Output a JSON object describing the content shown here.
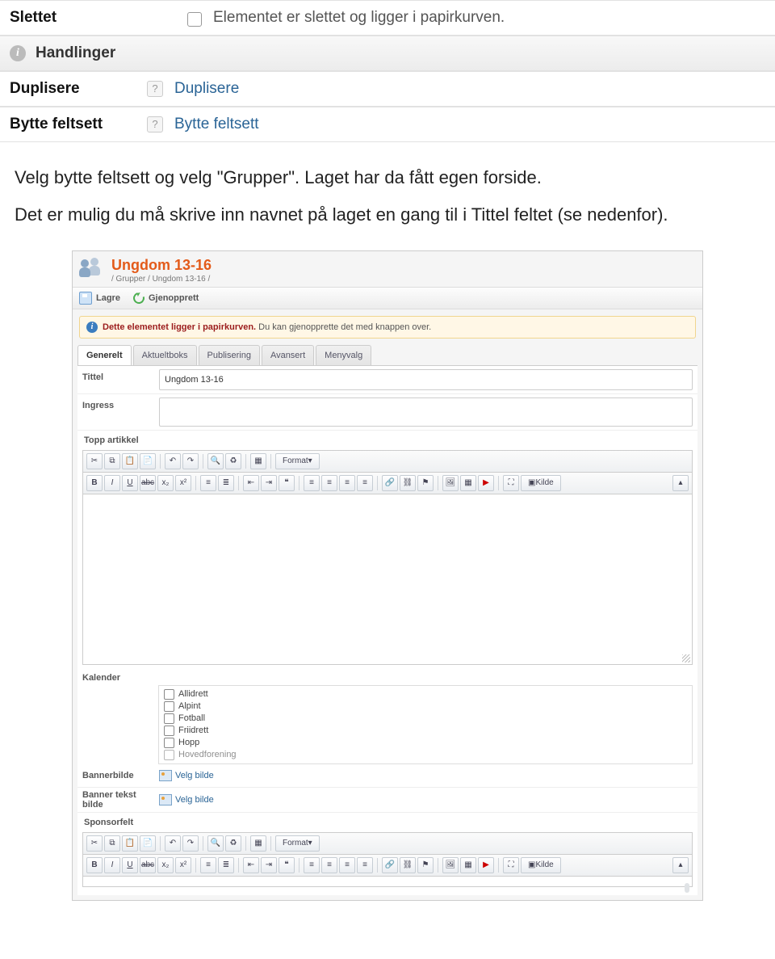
{
  "top": {
    "slettet_label": "Slettet",
    "slettet_desc": "Elementet er slettet og ligger i papirkurven.",
    "handlinger_label": "Handlinger",
    "duplisere_label": "Duplisere",
    "duplisere_link": "Duplisere",
    "bytte_label": "Bytte feltsett",
    "bytte_link": "Bytte feltsett"
  },
  "body_text_1": "Velg bytte feltsett og velg \"Grupper\". Laget har da fått egen forside.",
  "body_text_2": "Det er mulig du må skrive inn navnet på laget en gang til i Tittel feltet (se nedenfor).",
  "app": {
    "title": "Ungdom 13-16",
    "breadcrumb": "/ Grupper / Ungdom 13-16 /",
    "toolbar": {
      "save": "Lagre",
      "restore": "Gjenopprett"
    },
    "notice_bold": "Dette elementet ligger i papirkurven.",
    "notice_rest": " Du kan gjenopprette det med knappen over.",
    "tabs": [
      "Generelt",
      "Aktueltboks",
      "Publisering",
      "Avansert",
      "Menyvalg"
    ],
    "fields": {
      "tittel_label": "Tittel",
      "tittel_value": "Ungdom 13-16",
      "ingress_label": "Ingress",
      "topp_label": "Topp artikkel",
      "kalender_label": "Kalender",
      "bannerbilde_label": "Bannerbilde",
      "bannertekst_label": "Banner tekst bilde",
      "sponsor_label": "Sponsorfelt",
      "velg_bilde": "Velg bilde"
    },
    "calendar_items": [
      "Allidrett",
      "Alpint",
      "Fotball",
      "Friidrett",
      "Hopp",
      "Hovedforening"
    ],
    "rte": {
      "format": "Format",
      "kilde": "Kilde"
    }
  }
}
